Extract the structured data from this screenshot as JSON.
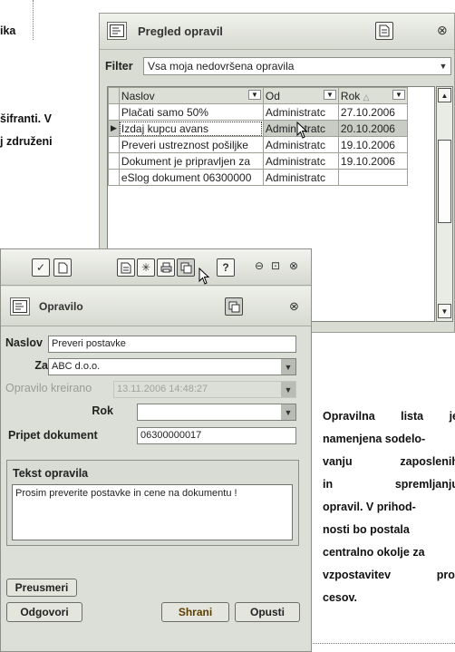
{
  "article": {
    "left_fragment_1": "ika",
    "left_fragment_2": "šifranti. V",
    "left_fragment_3": "j združeni",
    "side_lines": [
      [
        "Opravilna",
        "lista",
        "je"
      ],
      [
        "namenjena sodelo-"
      ],
      [
        "vanju",
        "zaposlenih"
      ],
      [
        "in",
        "spremljanju"
      ],
      [
        "opravil. V prihod-"
      ],
      [
        "nosti bo postala"
      ],
      [
        "centralno okolje za"
      ],
      [
        "vzpostavitev",
        "pro-"
      ],
      [
        "cesov."
      ]
    ]
  },
  "task_list_window": {
    "title": "Pregled opravil",
    "filter_label": "Filter",
    "filter_value": "Vsa moja nedovršena opravila",
    "columns": [
      "Naslov",
      "Od",
      "Rok"
    ],
    "rows": [
      {
        "naslov": "Plačati samo 50%",
        "od": "Administratc",
        "rok": "27.10.2006",
        "selected": false
      },
      {
        "naslov": "Izdaj kupcu avans",
        "od": "Administratc",
        "rok": "20.10.2006",
        "selected": true
      },
      {
        "naslov": "Preveri ustreznost pošiljke",
        "od": "Administratc",
        "rok": "19.10.2006",
        "selected": false
      },
      {
        "naslov": "Dokument je pripravljen za",
        "od": "Administratc",
        "rok": "19.10.2006",
        "selected": false
      },
      {
        "naslov": "eSlog dokument 06300000",
        "od": "Administratc",
        "rok": "",
        "selected": false
      }
    ]
  },
  "task_window": {
    "title": "Opravilo",
    "fields": {
      "naslov_label": "Naslov",
      "naslov_value": "Preveri postavke",
      "za_label": "Za",
      "za_value": "ABC d.o.o.",
      "kreirano_label": "Opravilo kreirano",
      "kreirano_value": "13.11.2006 14:48:27",
      "rok_label": "Rok",
      "rok_value": "",
      "pripet_label": "Pripet dokument",
      "pripet_value": "06300000017"
    },
    "text_section_label": "Tekst opravila",
    "text_value": "Prosim preverite postavke in cene na dokumentu !",
    "buttons": {
      "preusmeri": "Preusmeri",
      "odgovori": "Odgovori",
      "shrani": "Shrani",
      "opusti": "Opusti"
    }
  }
}
